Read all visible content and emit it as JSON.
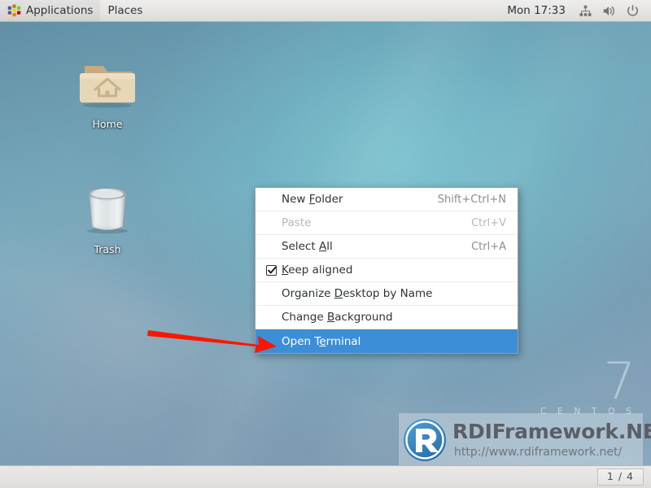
{
  "top_panel": {
    "applications_label": "Applications",
    "applications_icon": "gnome-applications-icon",
    "places_label": "Places",
    "clock": "Mon 17:33",
    "tray": [
      {
        "name": "network-icon",
        "label": "Network"
      },
      {
        "name": "volume-icon",
        "label": "Volume"
      },
      {
        "name": "power-icon",
        "label": "Power"
      }
    ]
  },
  "desktop": {
    "icons": [
      {
        "name": "home",
        "label": "Home",
        "icon": "home-folder-icon"
      },
      {
        "name": "trash",
        "label": "Trash",
        "icon": "trash-can-icon"
      }
    ],
    "branding": {
      "version": "7",
      "distro": "C E N T O S"
    }
  },
  "context_menu": {
    "highlight_color": "#3c8ed6",
    "items": [
      {
        "name": "new-folder",
        "label_before": "New ",
        "mnemonic": "F",
        "label_after": "older",
        "accel": "Shift+Ctrl+N",
        "disabled": false,
        "selected": false,
        "checkbox": false
      },
      {
        "name": "paste",
        "label_before": "Paste",
        "mnemonic": "",
        "label_after": "",
        "accel": "Ctrl+V",
        "disabled": true,
        "selected": false,
        "checkbox": false
      },
      {
        "name": "select-all",
        "label_before": "Select ",
        "mnemonic": "A",
        "label_after": "ll",
        "accel": "Ctrl+A",
        "disabled": false,
        "selected": false,
        "checkbox": false
      },
      {
        "name": "keep-aligned",
        "label_before": "",
        "mnemonic": "K",
        "label_after": "eep aligned",
        "accel": "",
        "disabled": false,
        "selected": false,
        "checkbox": true,
        "checked": true
      },
      {
        "name": "organize-desktop-by-name",
        "label_before": "Organize ",
        "mnemonic": "D",
        "label_after": "esktop by Name",
        "accel": "",
        "disabled": false,
        "selected": false,
        "checkbox": false
      },
      {
        "name": "change-background",
        "label_before": "Change ",
        "mnemonic": "B",
        "label_after": "ackground",
        "accel": "",
        "disabled": false,
        "selected": false,
        "checkbox": false
      },
      {
        "name": "open-terminal",
        "label_before": "Open T",
        "mnemonic": "e",
        "label_after": "rminal",
        "accel": "",
        "disabled": false,
        "selected": true,
        "checkbox": false
      }
    ]
  },
  "annotation": {
    "arrow_color": "#fb1600",
    "points_to": "open-terminal"
  },
  "watermark": {
    "logo": "rdi-r-logo",
    "title": "RDIFramework.NET",
    "url": "http://www.rdiframework.net/"
  },
  "bottom_panel": {
    "workspace_indicator": "1 / 4"
  }
}
